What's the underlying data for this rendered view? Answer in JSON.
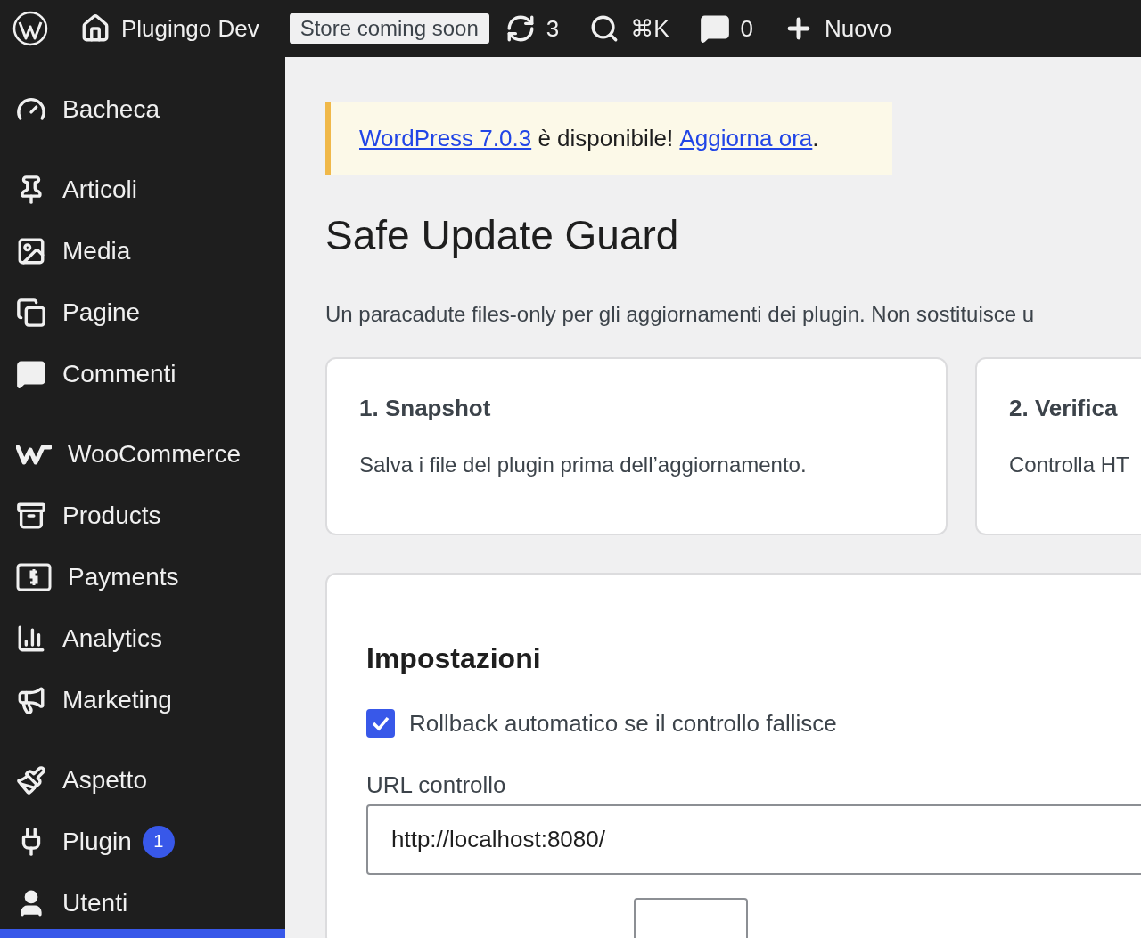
{
  "top_bar": {
    "site_name": "Plugingo Dev",
    "store_badge": "Store coming soon",
    "updates": "3",
    "search_shortcut": "⌘K",
    "comments": "0",
    "new_label": "Nuovo"
  },
  "sidebar": {
    "groups": [
      [
        {
          "label": "Bacheca"
        }
      ],
      [
        {
          "label": "Articoli"
        },
        {
          "label": "Media"
        },
        {
          "label": "Pagine"
        },
        {
          "label": "Commenti"
        }
      ],
      [
        {
          "label": "WooCommerce"
        },
        {
          "label": "Products"
        },
        {
          "label": "Payments"
        },
        {
          "label": "Analytics"
        },
        {
          "label": "Marketing"
        }
      ],
      [
        {
          "label": "Aspetto"
        },
        {
          "label": "Plugin",
          "badge": "1"
        },
        {
          "label": "Utenti"
        }
      ]
    ]
  },
  "notice": {
    "link": "WordPress 7.0.3",
    "text": " è disponibile! ",
    "action": "Aggiorna ora",
    "end": "."
  },
  "page_title": "Safe Update Guard",
  "description": "Un paracadute files-only per gli aggiornamenti dei plugin. Non sostituisce u",
  "steps": [
    {
      "title": "1. Snapshot",
      "text": "Salva i file del plugin prima dell’aggiornamento."
    },
    {
      "title": "2. Verifica",
      "text": "Controlla HT"
    }
  ],
  "settings": {
    "title": "Impostazioni",
    "rollback": {
      "label": "Rollback automatico se il controllo fallisce",
      "checked": true
    },
    "url_label": "URL controllo",
    "url_value": "http://localhost:8080/"
  }
}
